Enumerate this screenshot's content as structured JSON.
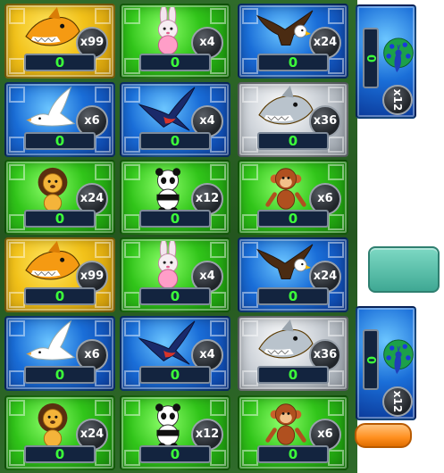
{
  "tiles": [
    {
      "animal": "shark",
      "color": "gold",
      "mult": "x99",
      "bet": "0"
    },
    {
      "animal": "rabbit",
      "color": "green",
      "mult": "x4",
      "bet": "0"
    },
    {
      "animal": "eagle",
      "color": "blue",
      "mult": "x24",
      "bet": "0"
    },
    {
      "animal": "dove",
      "color": "blue",
      "mult": "x6",
      "bet": "0"
    },
    {
      "animal": "swallow",
      "color": "blue",
      "mult": "x4",
      "bet": "0"
    },
    {
      "animal": "shark",
      "color": "silver",
      "mult": "x36",
      "bet": "0"
    },
    {
      "animal": "lion",
      "color": "green",
      "mult": "x24",
      "bet": "0"
    },
    {
      "animal": "panda",
      "color": "green",
      "mult": "x12",
      "bet": "0"
    },
    {
      "animal": "monkey",
      "color": "green",
      "mult": "x6",
      "bet": "0"
    },
    {
      "animal": "shark",
      "color": "gold",
      "mult": "x99",
      "bet": "0"
    },
    {
      "animal": "rabbit",
      "color": "green",
      "mult": "x4",
      "bet": "0"
    },
    {
      "animal": "eagle",
      "color": "blue",
      "mult": "x24",
      "bet": "0"
    },
    {
      "animal": "dove",
      "color": "blue",
      "mult": "x6",
      "bet": "0"
    },
    {
      "animal": "swallow",
      "color": "blue",
      "mult": "x4",
      "bet": "0"
    },
    {
      "animal": "shark",
      "color": "silver",
      "mult": "x36",
      "bet": "0"
    },
    {
      "animal": "lion",
      "color": "green",
      "mult": "x24",
      "bet": "0"
    },
    {
      "animal": "panda",
      "color": "green",
      "mult": "x12",
      "bet": "0"
    },
    {
      "animal": "monkey",
      "color": "green",
      "mult": "x6",
      "bet": "0"
    }
  ],
  "side_tiles": [
    {
      "animal": "peacock",
      "mult": "x12",
      "bet": "0"
    },
    {
      "animal": "peacock",
      "mult": "x12",
      "bet": "0"
    }
  ],
  "colors": {
    "bet_text": "#3cff3a",
    "teal_button": "#5cc2ad",
    "orange_button": "#ff8f1f"
  }
}
